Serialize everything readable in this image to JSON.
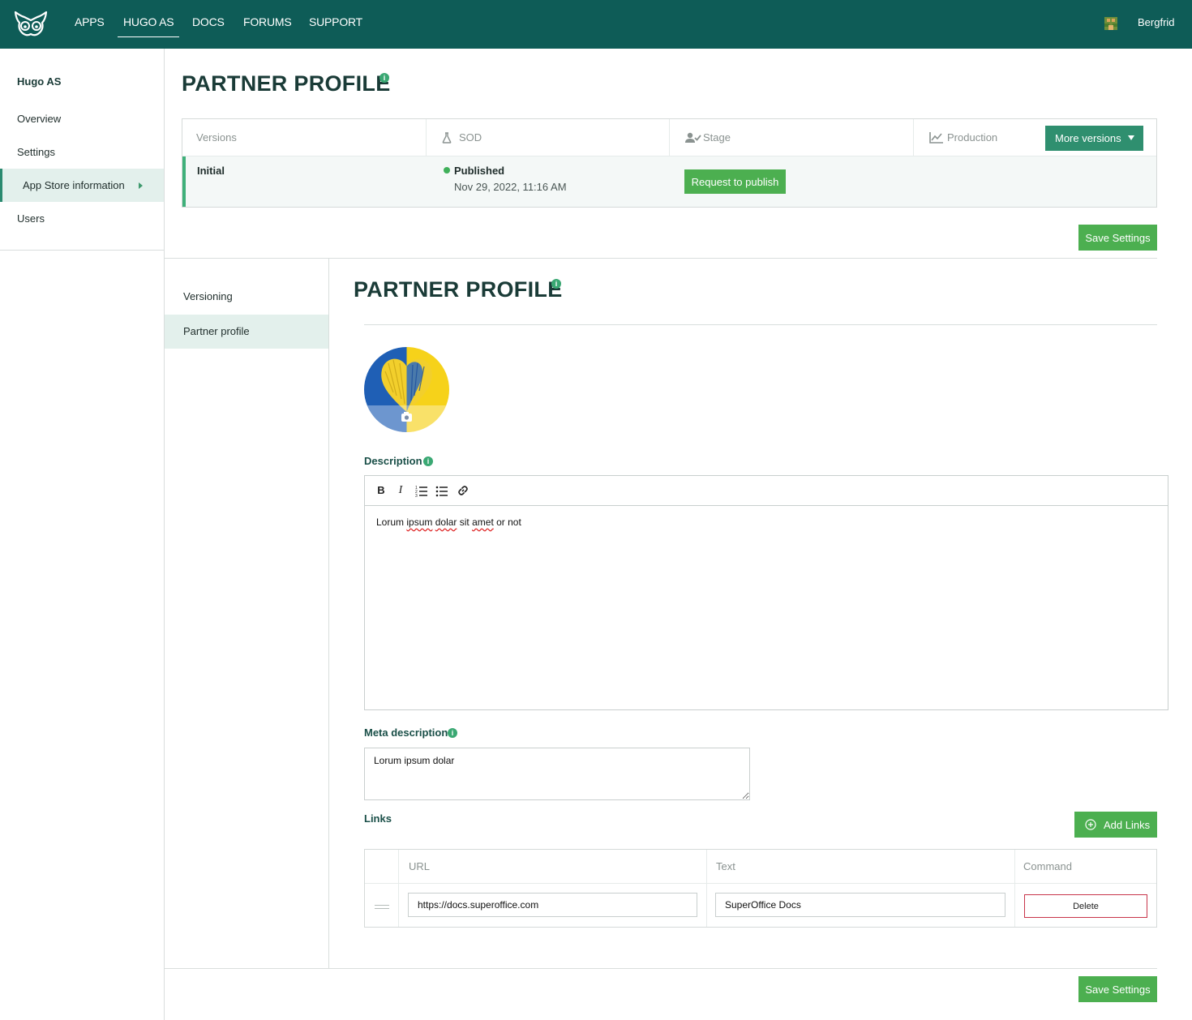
{
  "topnav": {
    "items": [
      {
        "label": "APPS"
      },
      {
        "label": "HUGO AS"
      },
      {
        "label": "DOCS"
      },
      {
        "label": "FORUMS"
      },
      {
        "label": "SUPPORT"
      }
    ],
    "active_index": 1,
    "user_name": "Bergfrid",
    "brand_color": "#0e5c57"
  },
  "sidebar": {
    "company": "Hugo AS",
    "items": [
      {
        "label": "Overview"
      },
      {
        "label": "Settings"
      },
      {
        "label": "App Store information"
      },
      {
        "label": "Users"
      }
    ],
    "active_index": 2
  },
  "header": {
    "title": "PARTNER PROFILE",
    "info_icon": "info-icon"
  },
  "versions": {
    "headers": {
      "versions": "Versions",
      "sod": "SOD",
      "stage": "Stage",
      "production": "Production"
    },
    "more_versions_label": "More versions",
    "row": {
      "name": "Initial",
      "status": "Published",
      "date": "Nov 29, 2022, 11:16 AM",
      "request_label": "Request to publish"
    }
  },
  "save_label": "Save Settings",
  "subnav": {
    "items": [
      {
        "label": "Versioning"
      },
      {
        "label": "Partner profile"
      }
    ],
    "active_index": 1
  },
  "form": {
    "title": "PARTNER PROFILE",
    "description_label": "Description",
    "description_text": {
      "w1": "Lorum",
      "w2": "ipsum",
      "w3": "dolar",
      "w4": "sit",
      "w5": "amet",
      "w6": "or not"
    },
    "editor_tools": [
      "bold-icon",
      "italic-icon",
      "ordered-list-icon",
      "bullet-list-icon",
      "link-icon"
    ],
    "meta_label": "Meta description",
    "meta_value": "Lorum ipsum dolar",
    "links_label": "Links",
    "add_links_label": "Add Links",
    "links_headers": {
      "url": "URL",
      "text": "Text",
      "command": "Command"
    },
    "links_rows": [
      {
        "url": "https://docs.superoffice.com",
        "text": "SuperOffice Docs",
        "delete_label": "Delete"
      }
    ]
  },
  "colors": {
    "accent_green": "#4caf50",
    "teal_button": "#2f8f6f",
    "active_bg": "#e3f0ec",
    "delete_border": "#c8354a"
  }
}
